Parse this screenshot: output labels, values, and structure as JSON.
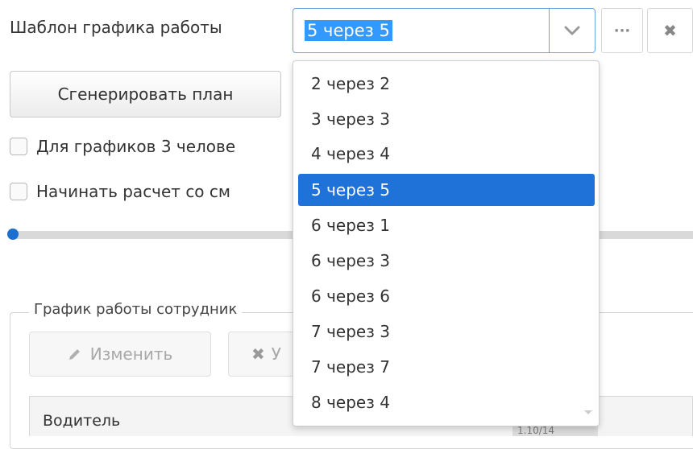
{
  "schedule_template": {
    "label": "Шаблон графика работы",
    "selected_value": "5 через 5",
    "more_label": "···",
    "clear_label": "✖"
  },
  "generate_button_label": "Сгенерировать план",
  "checkboxes": [
    {
      "label": "Для графиков 3 челове",
      "checked": false
    },
    {
      "label": "Начинать расчет со см",
      "checked": false
    }
  ],
  "slider": {
    "value_fraction": 0.0
  },
  "employee_schedule": {
    "legend": "График работы сотрудник",
    "edit_label": "Изменить",
    "delete_label": "У",
    "table_header": {
      "driver": "Водитель",
      "date_partial": "1.10/14"
    }
  },
  "dropdown": {
    "options": [
      "2 через 2",
      "3 через 3",
      "4 через 4",
      "5 через 5",
      "6 через 1",
      "6 через 3",
      "6 через 6",
      "7 через 3",
      "7 через 7",
      "8 через 4"
    ],
    "selected_index": 3
  },
  "colors": {
    "accent": "#1e72d8",
    "selection": "#3399ff"
  }
}
